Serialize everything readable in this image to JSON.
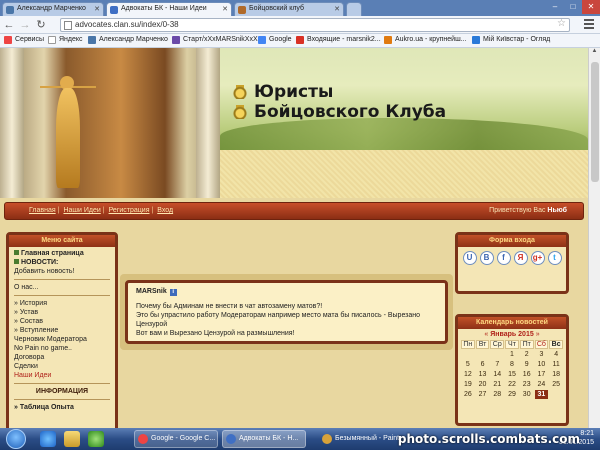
{
  "browser": {
    "tabs": [
      {
        "title": "Александр Марченко",
        "favicon_color": "#4a76a8"
      },
      {
        "title": "Адвокаты БК - Наши Идеи",
        "favicon_color": "#3f6fc4"
      },
      {
        "title": "Бойцовский клуб",
        "favicon_color": "#b06a2a"
      }
    ],
    "url": "advocates.clan.su/index/0-38",
    "bookmarks": [
      {
        "label": "Сервисы",
        "color": "#e44"
      },
      {
        "label": "Яндекс",
        "color": "#f4f4f4"
      },
      {
        "label": "Александр Марченко",
        "color": "#4a76a8"
      },
      {
        "label": "Старт/xXxMARSnikXxX",
        "color": "#6a4aa8"
      },
      {
        "label": "Google",
        "color": "#4285f4"
      },
      {
        "label": "Входящие - marsnik2...",
        "color": "#d93025"
      },
      {
        "label": "Aukro.ua - крупнейш...",
        "color": "#e07a10"
      },
      {
        "label": "Мій Київстар - Огляд",
        "color": "#2a7ad8"
      }
    ]
  },
  "site": {
    "title_line1": "Юристы",
    "title_line2": "Бойцовского Клуба",
    "nav": [
      "Главная",
      "Наши Идеи",
      "Регистрация",
      "Вход"
    ],
    "greeting_prefix": "Приветствую Вас",
    "greeting_name": "Ньюб"
  },
  "menu": {
    "title": "Меню сайта",
    "items_top": [
      {
        "label": "Главная страница",
        "style": "bold",
        "icon": "square-icon"
      },
      {
        "label": "НОВОСТИ:",
        "style": "bold",
        "icon": "square-icon"
      },
      {
        "label": "Добавить новость!",
        "style": "normal"
      }
    ],
    "items_mid": [
      {
        "label": "О нас...",
        "style": "normal"
      }
    ],
    "items_list": [
      {
        "label": "» История",
        "style": "normal"
      },
      {
        "label": "» Устав",
        "style": "normal"
      },
      {
        "label": "» Состав",
        "style": "normal"
      },
      {
        "label": "» Вступление",
        "style": "normal"
      },
      {
        "label": "Черновик Модератора",
        "style": "normal"
      },
      {
        "label": "No Pain no game..",
        "style": "normal"
      },
      {
        "label": "Договора",
        "style": "normal"
      },
      {
        "label": "Сделки",
        "style": "normal"
      },
      {
        "label": "Наши Идеи",
        "style": "red"
      }
    ],
    "info_header": "ИНФОРМАЦИЯ",
    "items_bottom": [
      {
        "label": "» Таблица Опыта",
        "style": "bold"
      }
    ]
  },
  "post": {
    "author": "MARSnik",
    "badge": "i",
    "lines": [
      "Почему бы Админам не внести в чат автозамену матов?!",
      "Это бы упрастило работу Модераторам например место мата бы писалось - Вырезано",
      "Цензурой",
      "Вот вам и Вырезано Цензурой на размышления!"
    ]
  },
  "login": {
    "title": "Форма входа",
    "social": [
      {
        "label": "U",
        "icon": "ucoz-icon"
      },
      {
        "label": "В",
        "icon": "vk-icon"
      },
      {
        "label": "f",
        "icon": "facebook-icon"
      },
      {
        "label": "Я",
        "icon": "yandex-icon"
      },
      {
        "label": "g+",
        "icon": "google-plus-icon"
      },
      {
        "label": "t",
        "icon": "twitter-icon"
      }
    ]
  },
  "calendar": {
    "title": "Календарь новостей",
    "prev": "«",
    "next": "»",
    "month": "Январь 2015",
    "day_names": [
      "Пн",
      "Вт",
      "Ср",
      "Чт",
      "Пт",
      "Сб",
      "Вс"
    ],
    "leading_blanks": 3,
    "days": 31,
    "today": 31
  },
  "taskbar": {
    "tasks": [
      {
        "label": "Google - Google C...",
        "color": "#e44"
      },
      {
        "label": "Адвокаты БК - Н...",
        "color": "#3f6fc4"
      },
      {
        "label": "Безымянный - Paint",
        "color": "#d8a23a"
      }
    ],
    "time": "8:21",
    "date": "31.01.2015"
  },
  "watermark": "photo.scrolls.combats.com"
}
